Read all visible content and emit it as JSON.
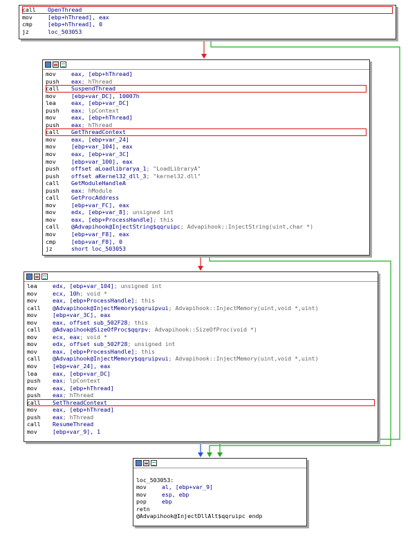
{
  "colors": {
    "highlight": "#dd1111",
    "edge_true": "#22aa22",
    "edge_false": "#dd2222",
    "edge_uncond": "#2255dd"
  },
  "block1": {
    "lines": [
      {
        "m": "call",
        "o": "OpenThread",
        "hl": true
      },
      {
        "m": "mov",
        "o": "[ebp+hThread], eax"
      },
      {
        "m": "cmp",
        "o": "[ebp+hThread], 0"
      },
      {
        "m": "jz",
        "o": "loc_503053"
      }
    ]
  },
  "block2": {
    "lines": [
      {
        "m": "mov",
        "o": "eax, [ebp+hThread]"
      },
      {
        "m": "push",
        "o": "eax",
        "c": "; hThread"
      },
      {
        "m": "call",
        "o": "SuspendThread",
        "hl": true
      },
      {
        "m": "mov",
        "o": "[ebp+var_DC], 10007h"
      },
      {
        "m": "lea",
        "o": "eax, [ebp+var_DC]"
      },
      {
        "m": "push",
        "o": "eax",
        "c": "; lpContext"
      },
      {
        "m": "mov",
        "o": "eax, [ebp+hThread]"
      },
      {
        "m": "push",
        "o": "eax",
        "c": "; hThread"
      },
      {
        "m": "call",
        "o": "GetThreadContext",
        "hl": true
      },
      {
        "m": "mov",
        "o": "eax, [ebp+var_24]"
      },
      {
        "m": "mov",
        "o": "[ebp+var_104], eax"
      },
      {
        "m": "mov",
        "o": "eax, [ebp+var_3C]"
      },
      {
        "m": "mov",
        "o": "[ebp+var_100], eax"
      },
      {
        "m": "push",
        "o": "offset aLoadlibrarya_1",
        "c": "; \"LoadLibraryA\""
      },
      {
        "m": "push",
        "o": "offset aKernel32_dll_3",
        "c": "; \"kernel32.dll\""
      },
      {
        "m": "call",
        "o": "GetModuleHandleA"
      },
      {
        "m": "push",
        "o": "eax",
        "c": "; hModule"
      },
      {
        "m": "call",
        "o": "GetProcAddress"
      },
      {
        "m": "mov",
        "o": "[ebp+var_FC], eax"
      },
      {
        "m": "mov",
        "o": "edx, [ebp+var_8]",
        "c": "; unsigned int"
      },
      {
        "m": "mov",
        "o": "eax, [ebp+ProcessHandle]",
        "c": "; this"
      },
      {
        "m": "call",
        "o": "@Advapihook@InjectString$qqruipc",
        "c": "; Advapihook::InjectString(uint,char *)"
      },
      {
        "m": "mov",
        "o": "[ebp+var_F8], eax"
      },
      {
        "m": "cmp",
        "o": "[ebp+var_F8], 0"
      },
      {
        "m": "jz",
        "o": "short loc_503053"
      }
    ]
  },
  "block3": {
    "lines": [
      {
        "m": "lea",
        "o": "edx, [ebp+var_104]",
        "c": "; unsigned int"
      },
      {
        "m": "mov",
        "o": "ecx, 10h",
        "c": "; void *"
      },
      {
        "m": "mov",
        "o": "eax, [ebp+ProcessHandle]",
        "c": "; this"
      },
      {
        "m": "call",
        "o": "@Advapihook@InjectMemory$qqruipvui",
        "c": "; Advapihook::InjectMemory(uint,void *,uint)"
      },
      {
        "m": "mov",
        "o": "[ebp+var_3C], eax"
      },
      {
        "m": "mov",
        "o": "eax, offset sub_502F28",
        "c": "; this"
      },
      {
        "m": "call",
        "o": "@Advapihook@SizeOfProc$qqrpv",
        "c": "; Advapihook::SizeOfProc(void *)"
      },
      {
        "m": "mov",
        "o": "ecx, eax",
        "c": "; void *"
      },
      {
        "m": "mov",
        "o": "edx, offset sub_502F28",
        "c": "; unsigned int"
      },
      {
        "m": "mov",
        "o": "eax, [ebp+ProcessHandle]",
        "c": "; this"
      },
      {
        "m": "call",
        "o": "@Advapihook@InjectMemory$qqruipvui",
        "c": "; Advapihook::InjectMemory(uint,void *,uint)"
      },
      {
        "m": "mov",
        "o": "[ebp+var_24], eax"
      },
      {
        "m": "lea",
        "o": "eax, [ebp+var_DC]"
      },
      {
        "m": "push",
        "o": "eax",
        "c": "; lpContext"
      },
      {
        "m": "mov",
        "o": "eax, [ebp+hThread]"
      },
      {
        "m": "push",
        "o": "eax",
        "c": "; hThread"
      },
      {
        "m": "call",
        "o": "SetThreadContext",
        "hl": true
      },
      {
        "m": "mov",
        "o": "eax, [ebp+hThread]"
      },
      {
        "m": "push",
        "o": "eax",
        "c": "; hThread"
      },
      {
        "m": "call",
        "o": "ResumeThread"
      },
      {
        "m": "mov",
        "o": "[ebp+var_9], 1"
      }
    ]
  },
  "block4": {
    "lines": [
      {
        "m": "",
        "o": ""
      },
      {
        "label": "loc_503053:"
      },
      {
        "m": "mov",
        "o": "al, [ebp+var_9]"
      },
      {
        "m": "mov",
        "o": "esp, ebp"
      },
      {
        "m": "pop",
        "o": "ebp"
      },
      {
        "m": "retn",
        "o": ""
      },
      {
        "label": "@Advapihook@InjectDllAlt$qqruipc endp"
      }
    ]
  }
}
